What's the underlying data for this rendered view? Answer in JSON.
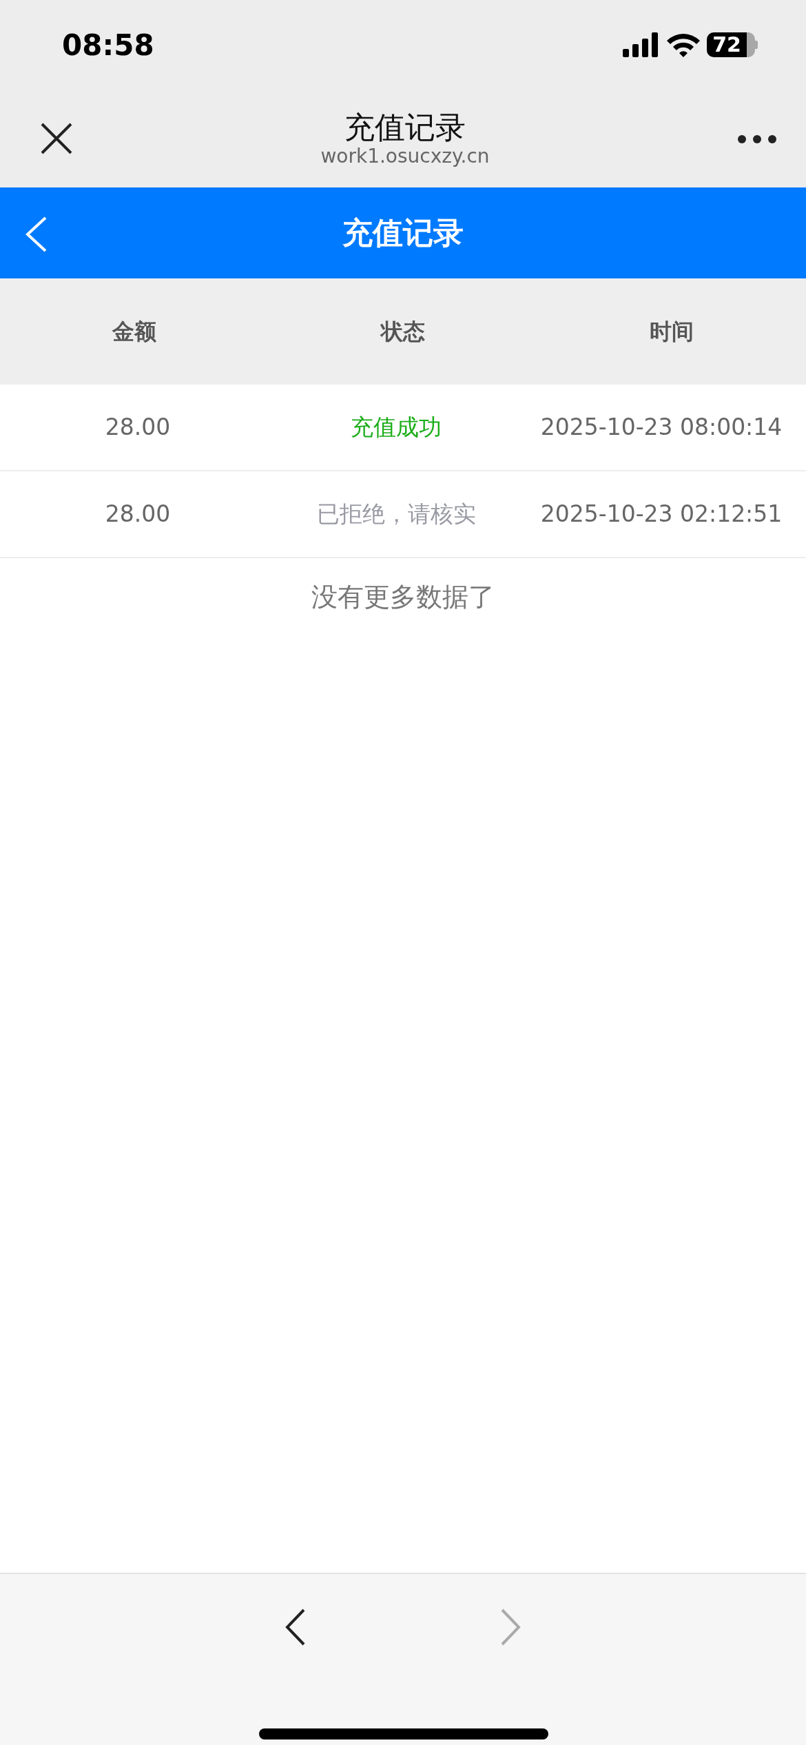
{
  "status_bar": {
    "time": "08:58",
    "battery": "72"
  },
  "browser_bar": {
    "title": "充值记录",
    "url": "work1.osucxzy.cn"
  },
  "header": {
    "title": "充值记录"
  },
  "table": {
    "columns": [
      "金额",
      "状态",
      "时间"
    ],
    "rows": [
      {
        "amount": "28.00",
        "status": "充值成功",
        "kind": "success",
        "time": "2025-10-23 08:00:14"
      },
      {
        "amount": "28.00",
        "status": "已拒绝，请核实",
        "kind": "rejected",
        "time": "2025-10-23 02:12:51"
      }
    ]
  },
  "end_message": "没有更多数据了",
  "bottom_nav": {
    "back_disabled": false,
    "forward_disabled": true
  }
}
